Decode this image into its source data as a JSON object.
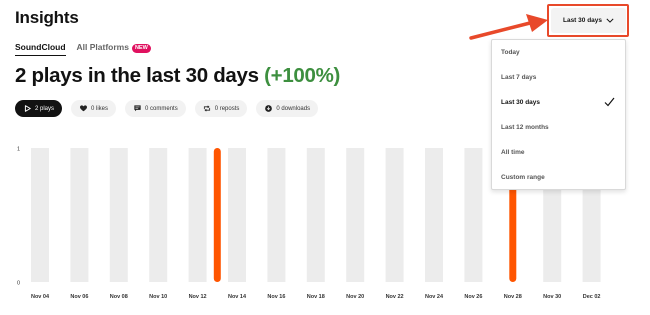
{
  "page": {
    "title": "Insights"
  },
  "platform_tabs": [
    {
      "label": "SoundCloud",
      "active": true
    },
    {
      "label": "All Platforms",
      "active": false,
      "badge": "NEW"
    }
  ],
  "headline": {
    "text": "2 plays in the last 30 days",
    "delta": "(+100%)"
  },
  "metrics": [
    {
      "label": "2 plays",
      "icon": "play-icon",
      "active": true
    },
    {
      "label": "0 likes",
      "icon": "heart-icon",
      "active": false
    },
    {
      "label": "0 comments",
      "icon": "comment-icon",
      "active": false
    },
    {
      "label": "0 reposts",
      "icon": "repost-icon",
      "active": false
    },
    {
      "label": "0 downloads",
      "icon": "download-icon",
      "active": false
    }
  ],
  "date_range": {
    "selected_label": "Last 30 days",
    "icon": "chevron-down-icon",
    "options": [
      {
        "label": "Today",
        "selected": false
      },
      {
        "label": "Last 7 days",
        "selected": false
      },
      {
        "label": "Last 30 days",
        "selected": true
      },
      {
        "label": "Last 12 months",
        "selected": false
      },
      {
        "label": "All time",
        "selected": false
      },
      {
        "label": "Custom range",
        "selected": false
      }
    ]
  },
  "colors": {
    "accent": "#ff5500",
    "bar_empty": "#ececec",
    "delta_positive": "#3d8f3f",
    "annotation": "#e8492a",
    "badge": "#e0115f"
  },
  "chart_data": {
    "type": "bar",
    "y_ticks": [
      "1",
      "0"
    ],
    "ylim": [
      0,
      1
    ],
    "x_tick_labels": [
      "Nov 04",
      "Nov 06",
      "Nov 08",
      "Nov 10",
      "Nov 12",
      "Nov 14",
      "Nov 16",
      "Nov 18",
      "Nov 20",
      "Nov 22",
      "Nov 24",
      "Nov 26",
      "Nov 28",
      "Nov 30",
      "Dec 02"
    ],
    "series": [
      {
        "x": [
          "Nov 04",
          "Nov 06",
          "Nov 08",
          "Nov 10",
          "Nov 12",
          "Nov 13",
          "Nov 14",
          "Nov 16",
          "Nov 18",
          "Nov 20",
          "Nov 22",
          "Nov 24",
          "Nov 26",
          "Nov 28",
          "Nov 30",
          "Dec 02"
        ],
        "values": [
          0,
          0,
          0,
          0,
          0,
          1,
          0,
          0,
          0,
          0,
          0,
          0,
          0,
          1,
          0,
          0
        ]
      }
    ]
  }
}
